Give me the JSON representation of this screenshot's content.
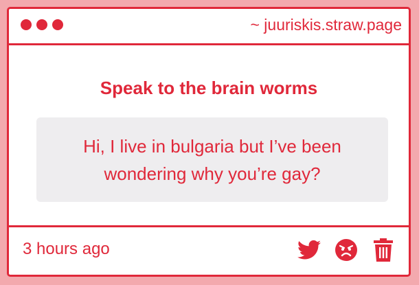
{
  "window": {
    "url": "~ juuriskis.straw.page"
  },
  "prompt": {
    "title": "Speak to the brain worms"
  },
  "message": {
    "text": "Hi, I live in bulgaria but I’ve been wondering why you’re gay?"
  },
  "footer": {
    "timestamp": "3 hours ago",
    "actions": [
      {
        "icon": "twitter-icon"
      },
      {
        "icon": "angry-face-icon"
      },
      {
        "icon": "trash-icon"
      }
    ]
  },
  "colors": {
    "accent": "#e0283a",
    "background": "#f3a9ae",
    "message_bg": "#eeedef",
    "card_bg": "#ffffff"
  }
}
